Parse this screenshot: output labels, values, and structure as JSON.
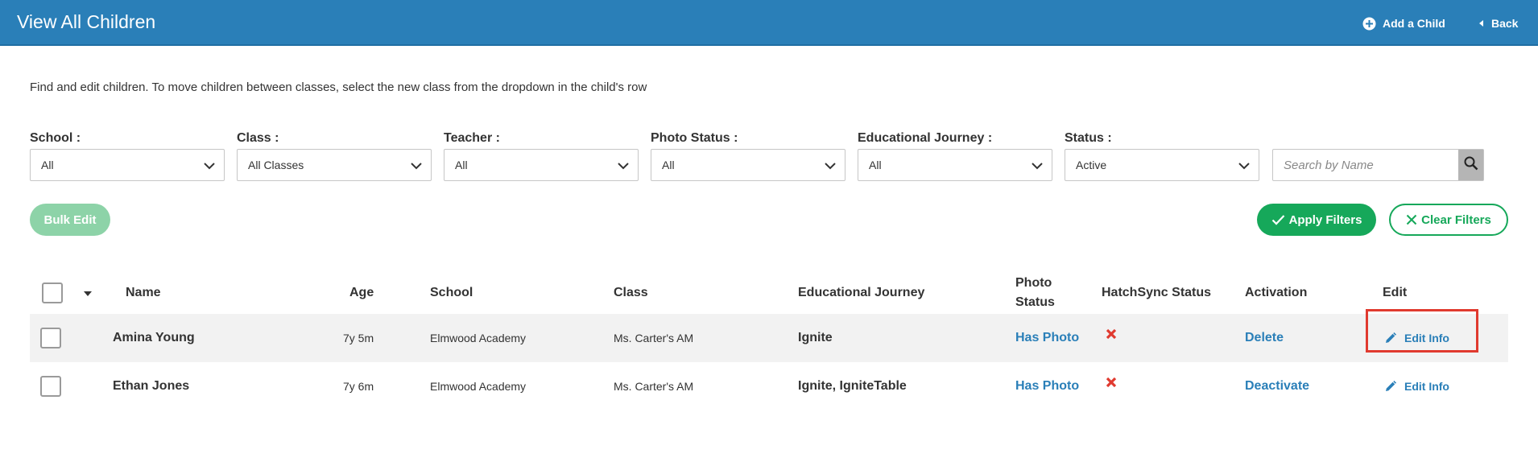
{
  "header": {
    "title": "View All Children",
    "add_child_label": "Add a Child",
    "back_label": "Back",
    "bg_color": "#2a7fb8"
  },
  "intro_text": "Find and edit children. To move children between classes, select the new class from the dropdown in the child's row",
  "filters": [
    {
      "label": "School :",
      "value": "All"
    },
    {
      "label": "Class :",
      "value": "All Classes"
    },
    {
      "label": "Teacher :",
      "value": "All"
    },
    {
      "label": "Photo Status :",
      "value": "All"
    },
    {
      "label": "Educational Journey :",
      "value": "All"
    },
    {
      "label": "Status :",
      "value": "Active"
    }
  ],
  "search": {
    "placeholder": "Search by Name",
    "icon": "search-icon"
  },
  "buttons": {
    "bulk_edit": "Bulk Edit",
    "apply_filters": "Apply Filters",
    "clear_filters": "Clear Filters",
    "accent_color": "#16a85a"
  },
  "table": {
    "headers": {
      "name": "Name",
      "age": "Age",
      "school": "School",
      "class": "Class",
      "journey": "Educational Journey",
      "photo_status_line1": "Photo",
      "photo_status_line2": "Status",
      "hatchsync": "HatchSync Status",
      "activation": "Activation",
      "edit": "Edit"
    },
    "rows": [
      {
        "name": "Amina Young",
        "age": "7y 5m",
        "school": "Elmwood Academy",
        "class": "Ms. Carter's AM",
        "journey": "Ignite",
        "photo_status": "Has Photo",
        "hatchsync_icon": "x-mark-icon",
        "activation": "Delete",
        "edit": "Edit Info"
      },
      {
        "name": "Ethan Jones",
        "age": "7y 6m",
        "school": "Elmwood Academy",
        "class": "Ms. Carter's AM",
        "journey": "Ignite, IgniteTable",
        "photo_status": "Has Photo",
        "hatchsync_icon": "x-mark-icon",
        "activation": "Deactivate",
        "edit": "Edit Info"
      }
    ]
  }
}
